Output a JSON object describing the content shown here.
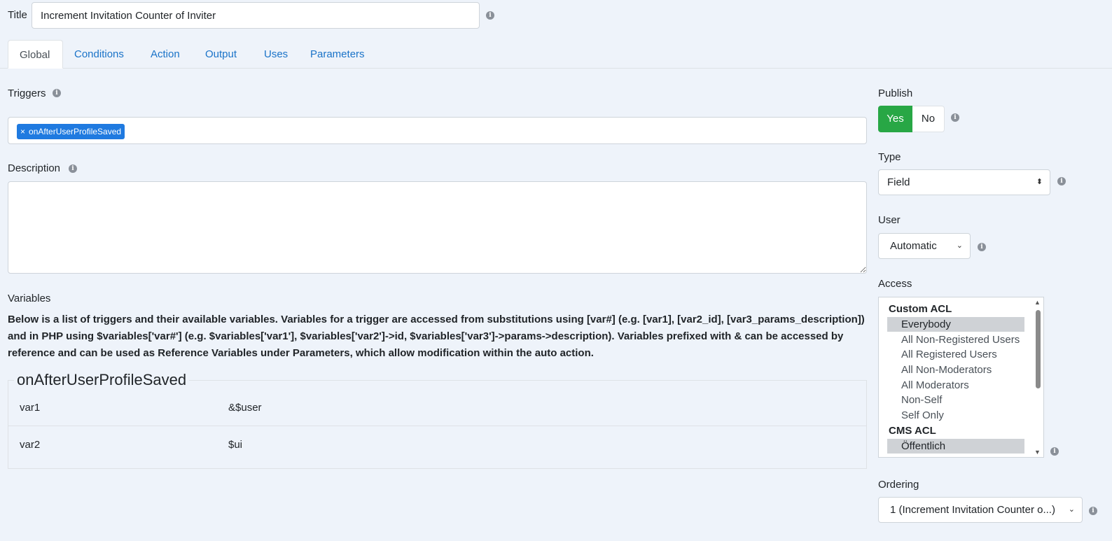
{
  "title_field": {
    "label": "Title",
    "value": "Increment Invitation Counter of Inviter"
  },
  "tabs": [
    {
      "label": "Global",
      "active": true
    },
    {
      "label": "Conditions"
    },
    {
      "label": "Action"
    },
    {
      "label": "Output"
    },
    {
      "label": "Uses"
    },
    {
      "label": "Parameters"
    }
  ],
  "triggers": {
    "label": "Triggers",
    "tags": [
      {
        "remove": "×",
        "label": "onAfterUserProfileSaved"
      }
    ]
  },
  "description": {
    "label": "Description",
    "value": ""
  },
  "variables": {
    "label": "Variables",
    "help_text": "Below is a list of triggers and their available variables. Variables for a trigger are accessed from substitutions using [var#] (e.g. [var1], [var2_id], [var3_params_description]) and in PHP using $variables['var#'] (e.g. $variables['var1'], $variables['var2']->id, $variables['var3']->params->description). Variables prefixed with & can be accessed by reference and can be used as Reference Variables under Parameters, which allow modification within the auto action.",
    "trigger_name": "onAfterUserProfileSaved",
    "rows": [
      {
        "name": "var1",
        "value": "&$user"
      },
      {
        "name": "var2",
        "value": "$ui"
      }
    ]
  },
  "publish": {
    "label": "Publish",
    "yes": "Yes",
    "no": "No",
    "selected": "Yes"
  },
  "type": {
    "label": "Type",
    "value": "Field"
  },
  "user": {
    "label": "User",
    "value": "Automatic"
  },
  "access": {
    "label": "Access",
    "groups": [
      {
        "label": "Custom ACL",
        "options": [
          "Everybody",
          "All Non-Registered Users",
          "All Registered Users",
          "All Non-Moderators",
          "All Moderators",
          "Non-Self",
          "Self Only"
        ]
      },
      {
        "label": "CMS ACL",
        "options": [
          "Öffentlich"
        ]
      }
    ],
    "selected": [
      "Everybody",
      "Öffentlich"
    ]
  },
  "ordering": {
    "label": "Ordering",
    "value": "1 (Increment Invitation Counter o...)"
  },
  "colors": {
    "accent": "#1a73c8",
    "success": "#28a745",
    "tag": "#1f7ae0",
    "background": "#eef3fa"
  },
  "icons": {
    "info": "info-circle-icon",
    "tag_remove": "close-icon",
    "select_arrow": "chevron-down-icon"
  }
}
